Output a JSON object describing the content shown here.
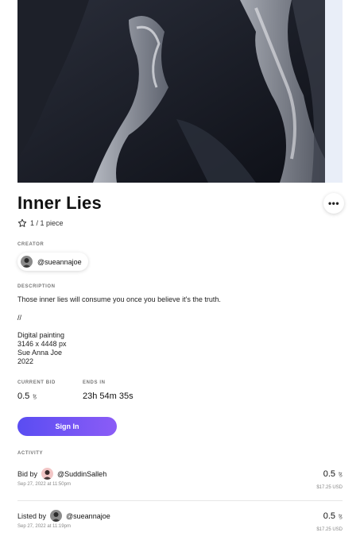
{
  "artwork": {
    "image_icon": "abstract-dark-brush-painting"
  },
  "title": "Inner Lies",
  "more_icon": "more-icon",
  "more_label": "•••",
  "edition": "1 / 1 piece",
  "creator": {
    "label": "CREATOR",
    "handle": "@sueannajoe"
  },
  "description": {
    "label": "DESCRIPTION",
    "text": "Those inner lies will consume you once you believe it's the truth.",
    "separator": "//",
    "medium": "Digital painting",
    "dimensions": "3146 x 4448 px",
    "artist": "Sue Anna Joe",
    "year": "2022"
  },
  "auction": {
    "current_bid_label": "CURRENT BID",
    "current_bid": "0.5",
    "currency_symbol": "ꜩ",
    "ends_in_label": "ENDS IN",
    "ends_in": "23h 54m 35s"
  },
  "sign_in_label": "Sign In",
  "activity": {
    "label": "ACTIVITY",
    "items": [
      {
        "action": "Bid by",
        "user": "@SuddinSalleh",
        "date": "Sep 27, 2022 at 11:50pm",
        "amount": "0.5",
        "usd": "$17.25 USD"
      },
      {
        "action": "Listed by",
        "user": "@sueannajoe",
        "date": "Sep 27, 2022 at 11:19pm",
        "amount": "0.5",
        "usd": "$17.25 USD"
      }
    ]
  },
  "colors": {
    "accent_start": "#5a4df2",
    "accent_end": "#8b5cf6",
    "artwork_bg": "#141720"
  }
}
